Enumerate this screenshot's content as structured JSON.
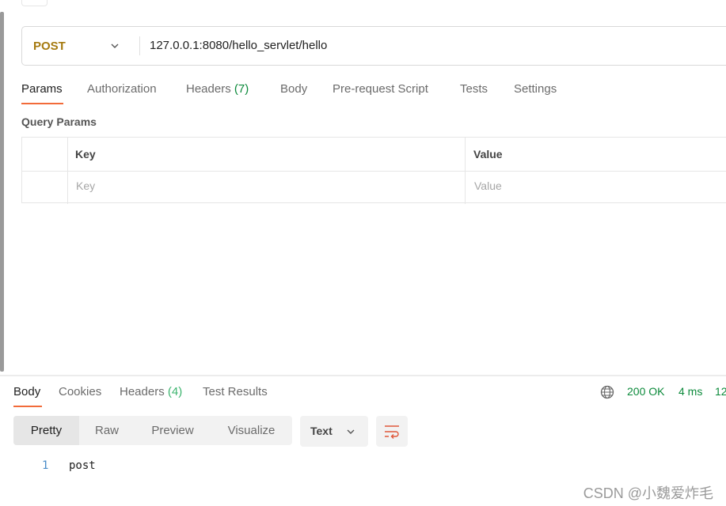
{
  "request": {
    "method": "POST",
    "url": "127.0.0.1:8080/hello_servlet/hello"
  },
  "request_tabs": [
    {
      "label": "Params"
    },
    {
      "label": "Authorization"
    },
    {
      "label": "Headers",
      "count": "(7)"
    },
    {
      "label": "Body"
    },
    {
      "label": "Pre-request Script"
    },
    {
      "label": "Tests"
    },
    {
      "label": "Settings"
    }
  ],
  "query_params": {
    "title": "Query Params",
    "headers": [
      "Key",
      "Value"
    ],
    "placeholders": {
      "key": "Key",
      "value": "Value"
    }
  },
  "response_tabs": [
    {
      "label": "Body"
    },
    {
      "label": "Cookies"
    },
    {
      "label": "Headers",
      "count": "(4)"
    },
    {
      "label": "Test Results"
    }
  ],
  "response_status": {
    "status": "200 OK",
    "time": "4 ms",
    "size": "12"
  },
  "view_modes": [
    "Pretty",
    "Raw",
    "Preview",
    "Visualize"
  ],
  "format": "Text",
  "response_body": [
    {
      "line": "1",
      "text": "post"
    }
  ],
  "watermark": "CSDN @小魏爱炸毛",
  "colors": {
    "accent": "#f26b3a",
    "method": "#a57a10",
    "success": "#0c8a3b"
  }
}
